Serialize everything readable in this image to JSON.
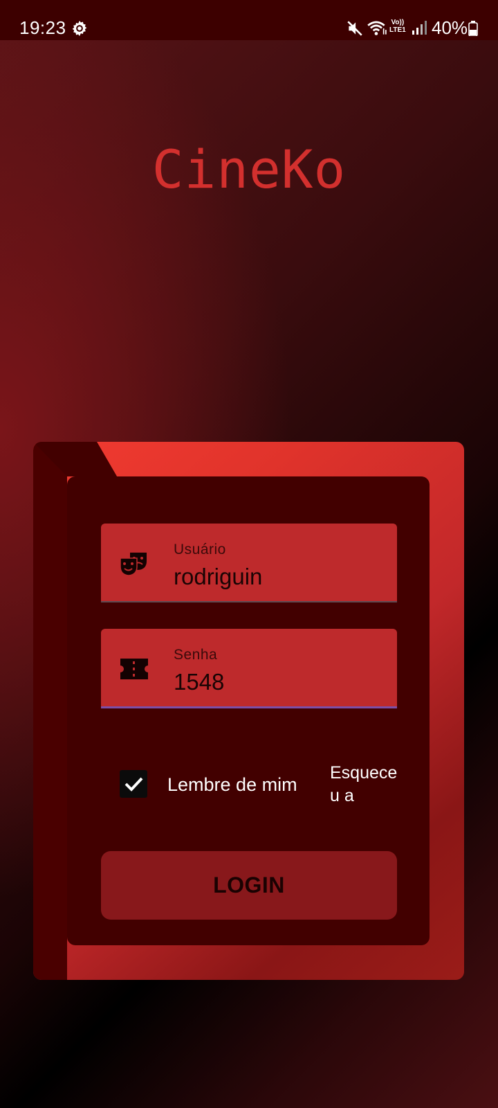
{
  "status_bar": {
    "time": "19:23",
    "network_label_top": "Vo))",
    "network_label_bottom": "LTE1",
    "battery": "40%",
    "icons": [
      "settings-icon",
      "mute-icon",
      "wifi-icon",
      "signal-icon",
      "battery-icon"
    ]
  },
  "app": {
    "title": "CineKo"
  },
  "login_form": {
    "username_label": "Usuário",
    "username_value": "rodriguin",
    "username_icon": "theater-masks-icon",
    "password_label": "Senha",
    "password_value": "1548",
    "password_icon": "ticket-icon",
    "remember_label": "Lembre de mim",
    "remember_checked": true,
    "forgot_label": "Esqueceu a",
    "login_button": "LOGIN"
  },
  "colors": {
    "status_bar": "#3d0000",
    "title": "#d3302e",
    "card_accent": "#f23b31",
    "panel": "#420000",
    "field": "#be2a2c",
    "button": "#88181b"
  }
}
